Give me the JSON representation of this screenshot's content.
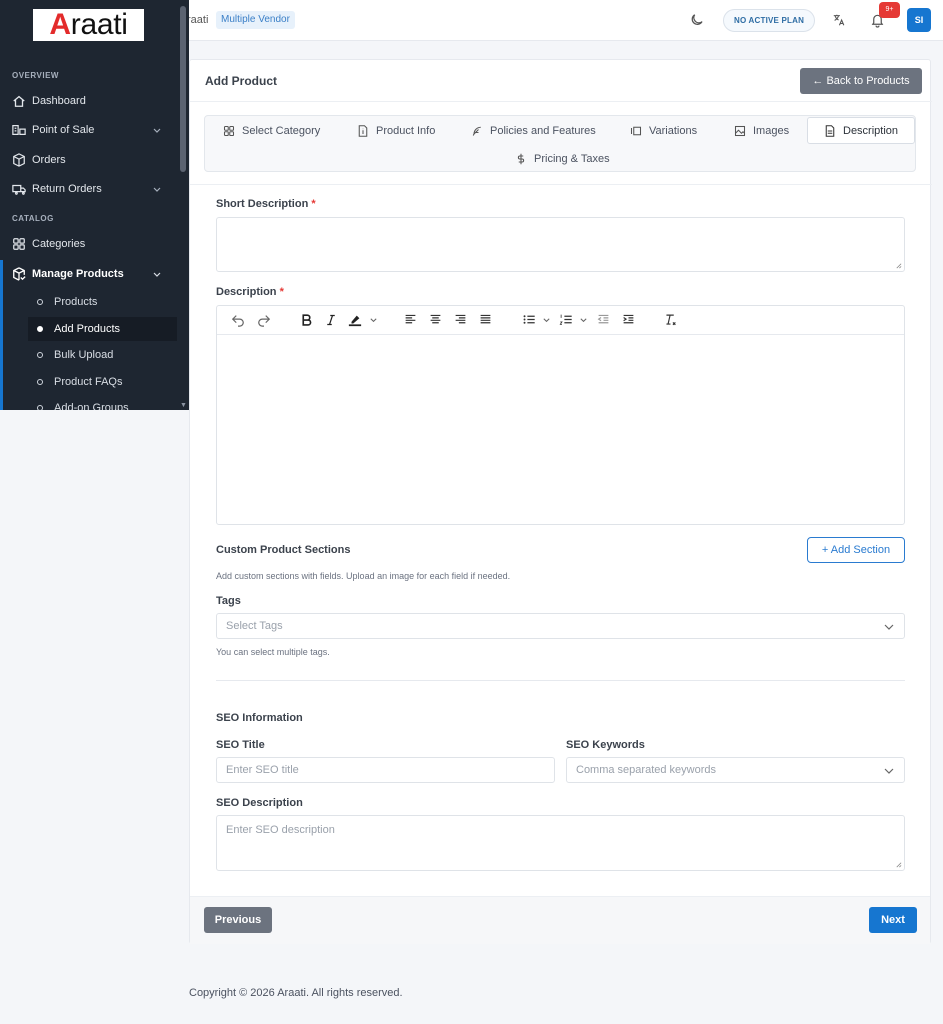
{
  "header": {
    "brand_fragment": "raati",
    "vendor_badge": "Multiple Vendor",
    "plan_badge": "NO ACTIVE PLAN",
    "notification_count": "9+",
    "avatar_initials": "SI"
  },
  "sidebar": {
    "logo_first": "A",
    "logo_rest": "raati",
    "sections": {
      "overview": "OVERVIEW",
      "catalog": "CATALOG"
    },
    "items": {
      "dashboard": "Dashboard",
      "pos": "Point of Sale",
      "orders": "Orders",
      "returns": "Return Orders",
      "categories": "Categories",
      "manage_products": "Manage Products"
    },
    "sub_items": [
      "Products",
      "Add Products",
      "Bulk Upload",
      "Product FAQs",
      "Add-on Groups"
    ]
  },
  "page": {
    "title": "Add Product",
    "back_button": "← Back to Products"
  },
  "tabs": [
    "Select Category",
    "Product Info",
    "Policies and Features",
    "Variations",
    "Images",
    "Description",
    "Pricing & Taxes"
  ],
  "active_tab": "Description",
  "form": {
    "short_desc_label": "Short Description",
    "description_label": "Description",
    "required_mark": "*",
    "custom_sections_label": "Custom Product Sections",
    "add_section_button": "+ Add Section",
    "custom_sections_hint": "Add custom sections with fields. Upload an image for each field if needed.",
    "tags_label": "Tags",
    "tags_placeholder": "Select Tags",
    "tags_hint": "You can select multiple tags.",
    "seo_heading": "SEO Information",
    "seo_title_label": "SEO Title",
    "seo_title_placeholder": "Enter SEO title",
    "seo_keywords_label": "SEO Keywords",
    "seo_keywords_placeholder": "Comma separated keywords",
    "seo_desc_label": "SEO Description",
    "seo_desc_placeholder": "Enter SEO description"
  },
  "footer": {
    "previous_button": "Previous",
    "next_button": "Next",
    "copyright": "Copyright © 2026 Araati. All rights reserved."
  }
}
